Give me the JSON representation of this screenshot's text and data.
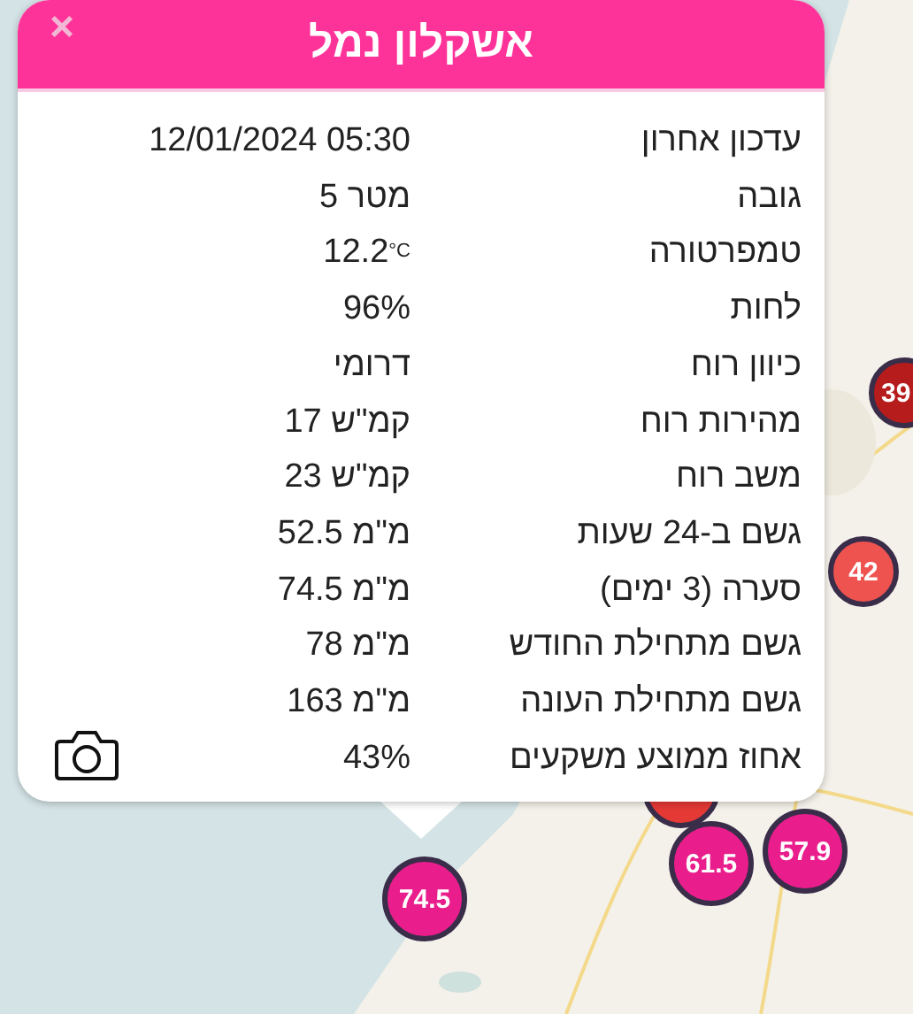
{
  "markers": [
    {
      "label": "39",
      "color": "#b71c1c"
    },
    {
      "label": "42",
      "color": "#ef5350"
    },
    {
      "color": "#e53935"
    },
    {
      "label": "61.5",
      "color": "#e91e8c"
    },
    {
      "label": "57.9",
      "color": "#e91e8c"
    },
    {
      "label": "74.5",
      "color": "#e91e8c"
    }
  ],
  "popup": {
    "title": "אשקלון נמל",
    "close": "×",
    "rows": [
      {
        "label": "עדכון אחרון",
        "value": "12/01/2024 05:30"
      },
      {
        "label": "גובה",
        "value": "5 מטר"
      },
      {
        "label": "טמפרטורה",
        "value": "12.2",
        "unit": "°C"
      },
      {
        "label": "לחות",
        "value": "96%"
      },
      {
        "label": "כיוון רוח",
        "value": "דרומי"
      },
      {
        "label": "מהירות רוח",
        "value": "17 קמ\"ש"
      },
      {
        "label": "משב רוח",
        "value": "23 קמ\"ש"
      },
      {
        "label": "גשם ב-24 שעות",
        "value": "52.5 מ\"מ"
      },
      {
        "label": "סערה (3 ימים)",
        "value": "74.5 מ\"מ"
      },
      {
        "label": "גשם מתחילת החודש",
        "value": "78 מ\"מ"
      },
      {
        "label": "גשם מתחילת העונה",
        "value": "163 מ\"מ"
      },
      {
        "label": "אחוז ממוצע משקעים",
        "value": "43%"
      }
    ]
  }
}
